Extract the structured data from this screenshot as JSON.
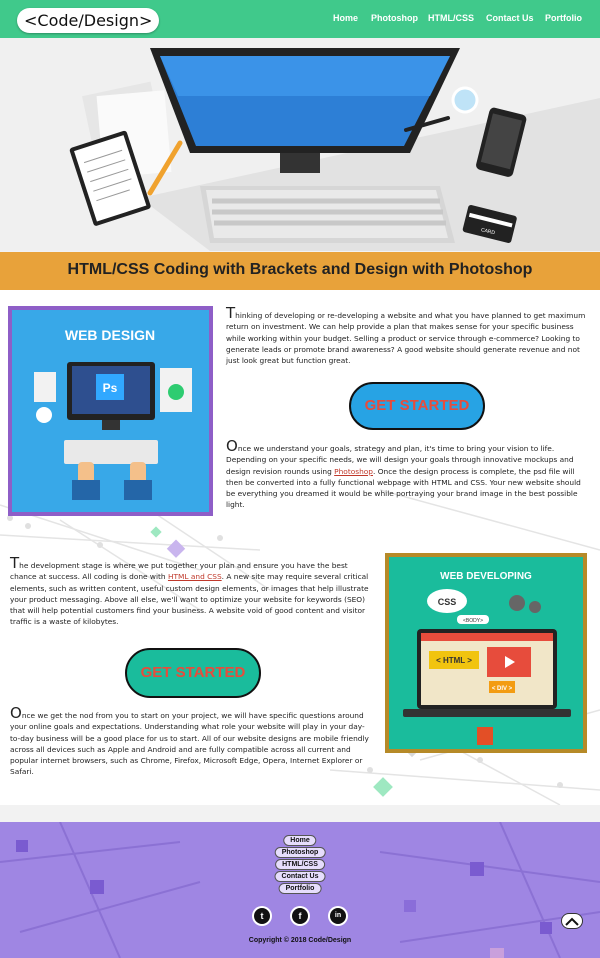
{
  "brand": {
    "logo_text": "<Code/Design>"
  },
  "nav": {
    "links": [
      "Home",
      "Photoshop",
      "HTML/CSS",
      "Contact Us",
      "Portfolio"
    ]
  },
  "banner": {
    "title": "HTML/CSS Coding with Brackets and Design with Photoshop"
  },
  "images": {
    "web_design_label": "WEB DESIGN",
    "ps_label": "Ps",
    "web_developing_label": "WEB DEVELOPING",
    "css_label": "CSS",
    "body_label": "<BODY>",
    "html_label": "< HTML >",
    "div_label": "< DIV >",
    "card_label": "CARD"
  },
  "sections": {
    "p1": {
      "lead": "T",
      "text": "hinking of developing or re-developing a website and what you have planned to get maximum return on investment. We can help provide a plan that makes sense for your specific business while working within your budget. Selling a product or service through e-commerce? Looking to generate leads or promote brand awareness? A good website should generate revenue and not just look great but function great."
    },
    "cta1": "GET STARTED",
    "p2": {
      "lead": "O",
      "text_before": "nce we understand your goals, strategy and plan, it's time to bring your vision to life. Depending on your specific needs, we will design your goals through innovative mockups and design revision rounds using ",
      "link": "Photoshop",
      "text_after": ". Once the design process is complete, the psd file will then be converted into a fully functional webpage with HTML and CSS. Your new website should be everything you dreamed it would be while portraying your brand image in the best possible light."
    },
    "p3": {
      "lead": "T",
      "text_before": "he development stage is where we put together your plan and ensure you have the best chance at success. All coding is done with ",
      "link": "HTML and CSS",
      "text_after": ". A new site may require several critical elements, such as written content, useful custom design elements, or images that help illustrate your product messaging. Above all else, we'll want to optimize your website for keywords (SEO) that will help potential customers find your business. A website void of good content and visitor traffic is a waste of kilobytes."
    },
    "cta2": "GET STARTED",
    "p4": {
      "lead": "O",
      "text": "nce we get the nod from you to start on your project, we will have specific questions around your online goals and expectations. Understanding what role your website will play in your day-to-day business will be a good place for us to start. All of our website designs are mobile friendly across all devices such as Apple and Android and are fully compatible across all current and popular internet browsers, such as Chrome, Firefox, Microsoft Edge, Opera, Internet Explorer or Safari."
    }
  },
  "footer": {
    "links": [
      "Home",
      "Photoshop",
      "HTML/CSS",
      "Contact Us",
      "Portfolio"
    ],
    "social": [
      "twitter-icon",
      "facebook-icon",
      "linkedin-icon"
    ],
    "social_glyphs": [
      "t",
      "f",
      "in"
    ],
    "copyright": "Copyright © 2018 Code/Design"
  },
  "colors": {
    "nav": "#40c98b",
    "banner": "#e8a23a",
    "footer": "#9f86e3",
    "cta_text": "#e74c3c",
    "link": "#c0392b"
  }
}
